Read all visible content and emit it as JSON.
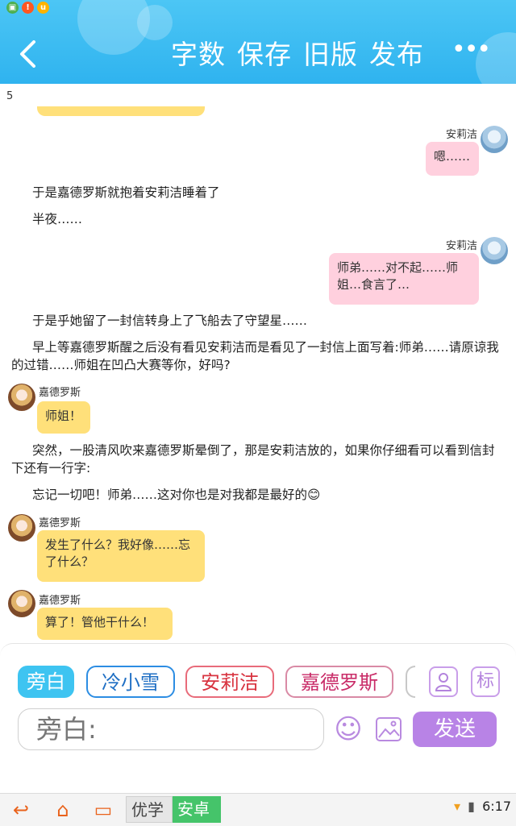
{
  "status_bar_icons": [
    {
      "name": "gallery-app-icon",
      "color": "#4caf50",
      "glyph": "▣"
    },
    {
      "name": "alert-icon",
      "color": "#ff5722",
      "glyph": "!"
    },
    {
      "name": "u-app-icon",
      "color": "#ffb300",
      "glyph": "u"
    }
  ],
  "header": {
    "back_glyph": "‹",
    "actions": [
      "字数",
      "保存",
      "旧版",
      "发布"
    ],
    "more_glyph": "•••",
    "bg_color": "#2fb3ef"
  },
  "chat": {
    "page_number": "5",
    "speaker1": "安莉洁",
    "msg1": "嗯……",
    "narr1": "于是嘉德罗斯就抱着安莉洁睡着了",
    "narr2": "半夜……",
    "speaker2": "安莉洁",
    "msg2": "师弟……对不起……师姐…食言了…",
    "narr3": "于是乎她留了一封信转身上了飞船去了守望星……",
    "narr4": "早上等嘉德罗斯醒之后没有看见安莉洁而是看见了一封信上面写着:师弟……请原谅我的过错……师姐在凹凸大赛等你，好吗?",
    "speaker3": "嘉德罗斯",
    "msg3": "师姐！",
    "narr5": "突然，一股清风吹来嘉德罗斯晕倒了，那是安莉洁放的，如果你仔细看可以看到信封下还有一行字:",
    "narr6": "忘记一切吧！师弟……这对你也是对我都是最好的😊",
    "speaker4": "嘉德罗斯",
    "msg4": "发生了什么？我好像……忘了什么？",
    "speaker5": "嘉德罗斯",
    "msg5": "算了！管他干什么！"
  },
  "composer": {
    "chips": [
      "旁白",
      "冷小雪",
      "安莉洁",
      "嘉德罗斯"
    ],
    "chip_person_icon": "person-icon",
    "chip_tag_label": "标",
    "input_placeholder": "旁白:",
    "emoji_icon": "☺",
    "image_icon": "▨",
    "send_label": "发送"
  },
  "navbar": {
    "back_glyph": "↩",
    "home_glyph": "⌂",
    "recent_glyph": "▭",
    "tag_grey": "优学",
    "tag_green": "安卓",
    "wifi_glyph": "▾",
    "battery_glyph": "▮",
    "time": "6:17"
  },
  "colors": {
    "pink_bubble": "#ffd0de",
    "yellow_bubble": "#ffe07a",
    "send_button": "#b883e6",
    "active_chip": "#3ec4f1"
  }
}
